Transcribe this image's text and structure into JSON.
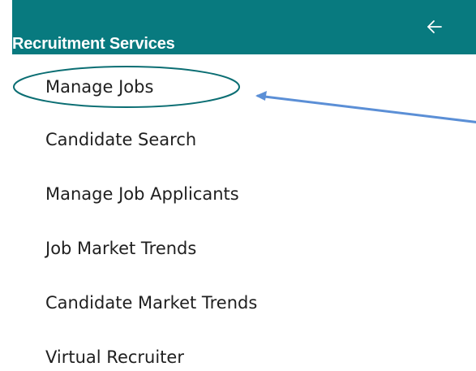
{
  "header": {
    "title": "Recruitment Services",
    "back_icon": "arrow-left-icon",
    "background_color": "#087a7f",
    "text_color": "#ffffff"
  },
  "menu": {
    "items": [
      {
        "label": "Manage Jobs",
        "highlighted": true
      },
      {
        "label": "Candidate Search"
      },
      {
        "label": "Manage Job Applicants"
      },
      {
        "label": "Job Market Trends"
      },
      {
        "label": "Candidate Market Trends"
      },
      {
        "label": "Virtual Recruiter"
      }
    ]
  },
  "annotation": {
    "ellipse_color": "#0b6e73",
    "arrow_color": "#5b8fd6"
  }
}
